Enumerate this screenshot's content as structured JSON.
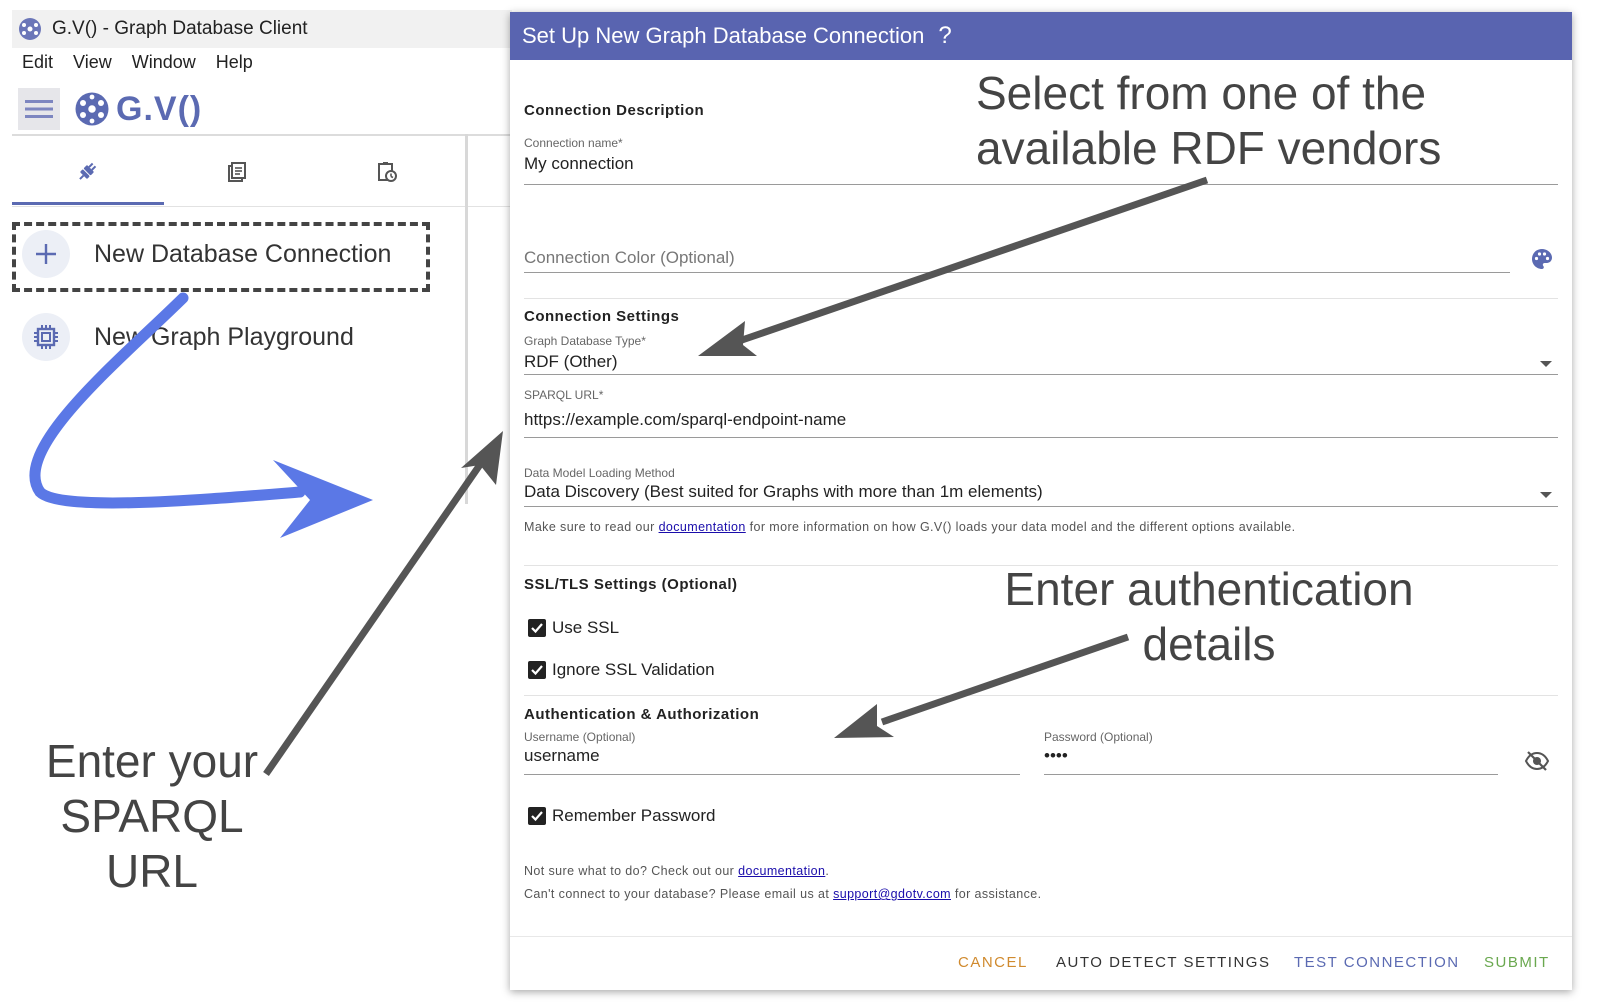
{
  "app": {
    "window_title": "G.V() - Graph Database Client",
    "menu": [
      "Edit",
      "View",
      "Window",
      "Help"
    ],
    "brand": "G.V()",
    "nav": {
      "new_connection": "New Database Connection",
      "new_playground": "New Graph Playground"
    }
  },
  "dialog": {
    "title": "Set Up New Graph Database Connection",
    "help_glyph": "?",
    "connection_description": {
      "section": "Connection Description",
      "name_label": "Connection name*",
      "name_value": "My connection",
      "color_placeholder": "Connection Color (Optional)"
    },
    "connection_settings": {
      "section": "Connection Settings",
      "type_label": "Graph Database Type*",
      "type_value": "RDF (Other)",
      "sparql_label": "SPARQL URL*",
      "sparql_value": "https://example.com/sparql-endpoint-name",
      "loading_label": "Data Model Loading Method",
      "loading_value": "Data Discovery (Best suited for Graphs with more than 1m elements)",
      "help_prefix": "Make sure to read our ",
      "help_link": "documentation",
      "help_suffix": " for more information on how G.V() loads your data model and the different options available."
    },
    "ssl": {
      "section": "SSL/TLS Settings (Optional)",
      "use_ssl": "Use SSL",
      "ignore_validation": "Ignore SSL Validation"
    },
    "auth": {
      "section": "Authentication & Authorization",
      "username_label": "Username (Optional)",
      "username_value": "username",
      "password_label": "Password (Optional)",
      "password_value": "••••",
      "remember": "Remember Password"
    },
    "footer_help": {
      "line1_prefix": "Not sure what to do? Check out our ",
      "line1_link": "documentation",
      "line1_suffix": ".",
      "line2_prefix": "Can't connect to your database? Please email us at ",
      "line2_link": "support@gdotv.com",
      "line2_suffix": " for assistance."
    },
    "buttons": {
      "cancel": "CANCEL",
      "auto_detect": "AUTO DETECT SETTINGS",
      "test": "TEST CONNECTION",
      "submit": "SUBMIT"
    },
    "colors": {
      "header": "#5964b0",
      "cancel": "#d08a2e",
      "test": "#5b6ab2",
      "submit": "#6aa84f"
    }
  },
  "annotations": {
    "vendors_line1": "Select from one of the",
    "vendors_line2": "available RDF vendors",
    "auth_line1": "Enter authentication",
    "auth_line2": "details",
    "sparql_line1": "Enter your",
    "sparql_line2": "SPARQL URL"
  }
}
